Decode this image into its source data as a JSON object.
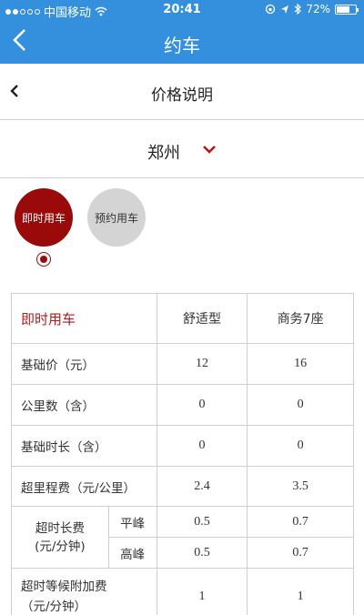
{
  "status_bar": {
    "carrier": "中国移动",
    "time": "20:41",
    "battery": "72%",
    "battery_level": 0.72
  },
  "nav": {
    "title": "约车"
  },
  "subheader": {
    "title": "价格说明"
  },
  "city": {
    "name": "郑州"
  },
  "tabs": [
    {
      "label": "即时用车",
      "active": true
    },
    {
      "label": "预约用车",
      "active": false
    }
  ],
  "colors": {
    "nav_blue": "#3490dd",
    "accent_red": "#9a0a0a",
    "inactive_gray": "#d4d4d4"
  },
  "table": {
    "header": {
      "title": "即时用车",
      "col1": "舒适型",
      "col2": "商务7座"
    },
    "rows": [
      {
        "label": "基础价（元）",
        "c1": "12",
        "c2": "16"
      },
      {
        "label": "公里数（含）",
        "c1": "0",
        "c2": "0"
      },
      {
        "label": "基础时长（含）",
        "c1": "0",
        "c2": "0"
      },
      {
        "label": "超里程费（元/公里）",
        "c1": "2.4",
        "c2": "3.5"
      }
    ],
    "overtime": {
      "label_line1": "超时长费",
      "label_line2": "(元/分钟)",
      "peak": {
        "label": "平峰",
        "c1": "0.5",
        "c2": "0.7"
      },
      "high": {
        "label": "高峰",
        "c1": "0.5",
        "c2": "0.7"
      }
    },
    "waiting": {
      "label_line1": "超时等候附加费",
      "label_line2": "（元/分钟）",
      "c1": "1",
      "c2": "1"
    }
  }
}
